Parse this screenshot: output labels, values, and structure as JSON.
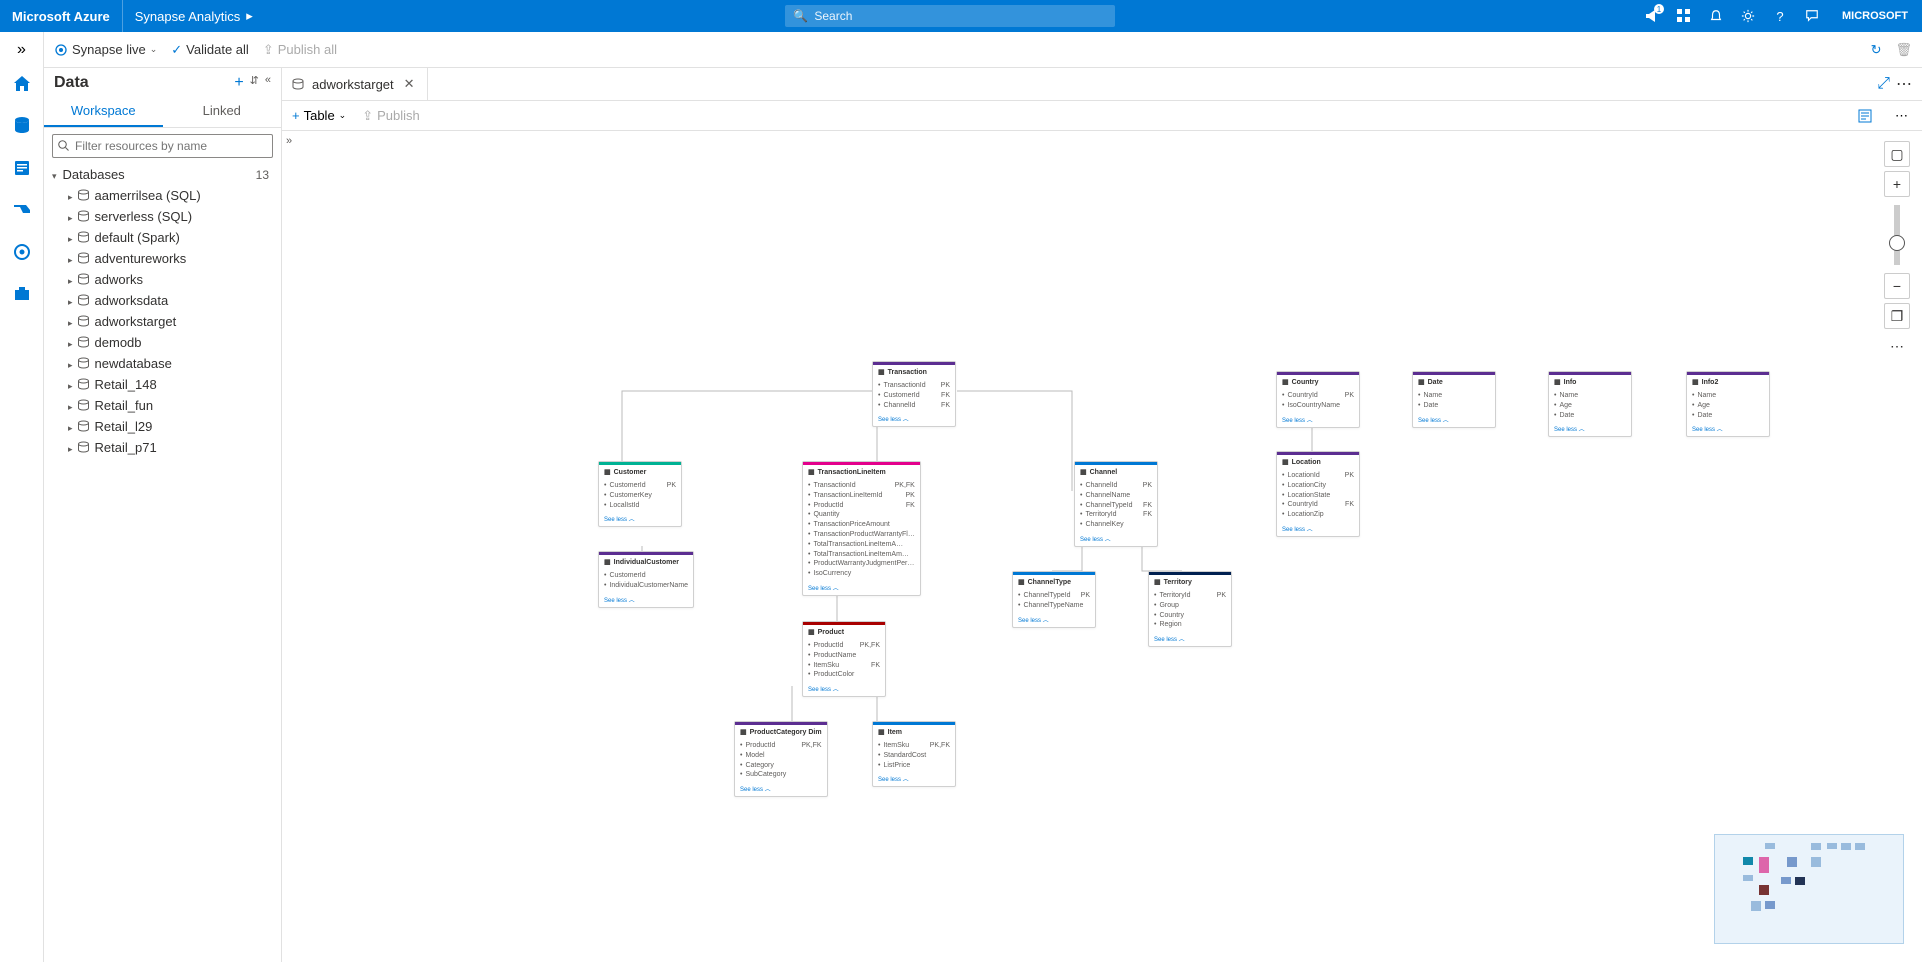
{
  "header": {
    "brand": "Microsoft Azure",
    "product": "Synapse Analytics",
    "search_placeholder": "Search",
    "notification_count": "1",
    "account": "MICROSOFT"
  },
  "subheader": {
    "live": "Synapse live",
    "validate": "Validate all",
    "publish": "Publish all"
  },
  "data_panel": {
    "title": "Data",
    "tabs": {
      "workspace": "Workspace",
      "linked": "Linked"
    },
    "filter_placeholder": "Filter resources by name",
    "databases_label": "Databases",
    "databases_count": "13",
    "items": [
      "aamerrilsea (SQL)",
      "serverless (SQL)",
      "default (Spark)",
      "adventureworks",
      "adworks",
      "adworksdata",
      "adworkstarget",
      "demodb",
      "newdatabase",
      "Retail_148",
      "Retail_fun",
      "Retail_l29",
      "Retail_p71"
    ]
  },
  "editor": {
    "tab_title": "adworkstarget",
    "plus_table": "Table",
    "publish": "Publish",
    "see_less": "See less"
  },
  "entities": {
    "transaction": {
      "title": "Transaction",
      "cols": [
        [
          "TransactionId",
          "PK"
        ],
        [
          "CustomerId",
          "FK"
        ],
        [
          "ChannelId",
          "FK"
        ]
      ]
    },
    "customer": {
      "title": "Customer",
      "cols": [
        [
          "CustomerId",
          "PK"
        ],
        [
          "CustomerKey",
          ""
        ],
        [
          "LocalIstId",
          ""
        ]
      ]
    },
    "individual": {
      "title": "IndividualCustomer",
      "cols": [
        [
          "CustomerId",
          ""
        ],
        [
          "IndividualCustomerName",
          ""
        ]
      ]
    },
    "lineitem": {
      "title": "TransactionLineItem",
      "cols": [
        [
          "TransactionId",
          "PK,FK"
        ],
        [
          "TransactionLineItemId",
          "PK"
        ],
        [
          "ProductId",
          "FK"
        ],
        [
          "Quantity",
          ""
        ],
        [
          "TransactionPriceAmount",
          ""
        ],
        [
          "TransactionProductWarrantyFl…",
          ""
        ],
        [
          "TotalTransactionLineItemA…",
          ""
        ],
        [
          "TotalTransactionLineItemAm…",
          ""
        ],
        [
          "ProductWarrantyJudgmentPer…",
          ""
        ],
        [
          "IsoCurrency",
          ""
        ]
      ]
    },
    "channel": {
      "title": "Channel",
      "cols": [
        [
          "ChannelId",
          "PK"
        ],
        [
          "ChannelName",
          ""
        ],
        [
          "ChannelTypeId",
          "FK"
        ],
        [
          "TerritoryId",
          "FK"
        ],
        [
          "ChannelKey",
          ""
        ]
      ]
    },
    "channeltype": {
      "title": "ChannelType",
      "cols": [
        [
          "ChannelTypeId",
          "PK"
        ],
        [
          "ChannelTypeName",
          ""
        ]
      ]
    },
    "territory": {
      "title": "Territory",
      "cols": [
        [
          "TerritoryId",
          "PK"
        ],
        [
          "Group",
          ""
        ],
        [
          "Country",
          ""
        ],
        [
          "Region",
          ""
        ]
      ]
    },
    "product": {
      "title": "Product",
      "cols": [
        [
          "ProductId",
          "PK,FK"
        ],
        [
          "ProductName",
          ""
        ],
        [
          "ItemSku",
          "FK"
        ],
        [
          "ProductColor",
          ""
        ]
      ]
    },
    "prodcat": {
      "title": "ProductCategory Dim",
      "cols": [
        [
          "ProductId",
          "PK,FK"
        ],
        [
          "Model",
          ""
        ],
        [
          "Category",
          ""
        ],
        [
          "SubCategory",
          ""
        ]
      ]
    },
    "item": {
      "title": "Item",
      "cols": [
        [
          "ItemSku",
          "PK,FK"
        ],
        [
          "StandardCost",
          ""
        ],
        [
          "ListPrice",
          ""
        ]
      ]
    },
    "country": {
      "title": "Country",
      "cols": [
        [
          "CountryId",
          "PK"
        ],
        [
          "IsoCountryName",
          ""
        ]
      ]
    },
    "location": {
      "title": "Location",
      "cols": [
        [
          "LocationId",
          "PK"
        ],
        [
          "LocationCity",
          ""
        ],
        [
          "LocationState",
          ""
        ],
        [
          "CountryId",
          "FK"
        ],
        [
          "LocationZip",
          ""
        ]
      ]
    },
    "date": {
      "title": "Date",
      "cols": [
        [
          "Name",
          ""
        ],
        [
          "Date",
          ""
        ]
      ]
    },
    "info": {
      "title": "Info",
      "cols": [
        [
          "Name",
          ""
        ],
        [
          "Age",
          ""
        ],
        [
          "Date",
          ""
        ]
      ]
    },
    "info2": {
      "title": "Info2",
      "cols": [
        [
          "Name",
          ""
        ],
        [
          "Age",
          ""
        ],
        [
          "Date",
          ""
        ]
      ]
    }
  }
}
